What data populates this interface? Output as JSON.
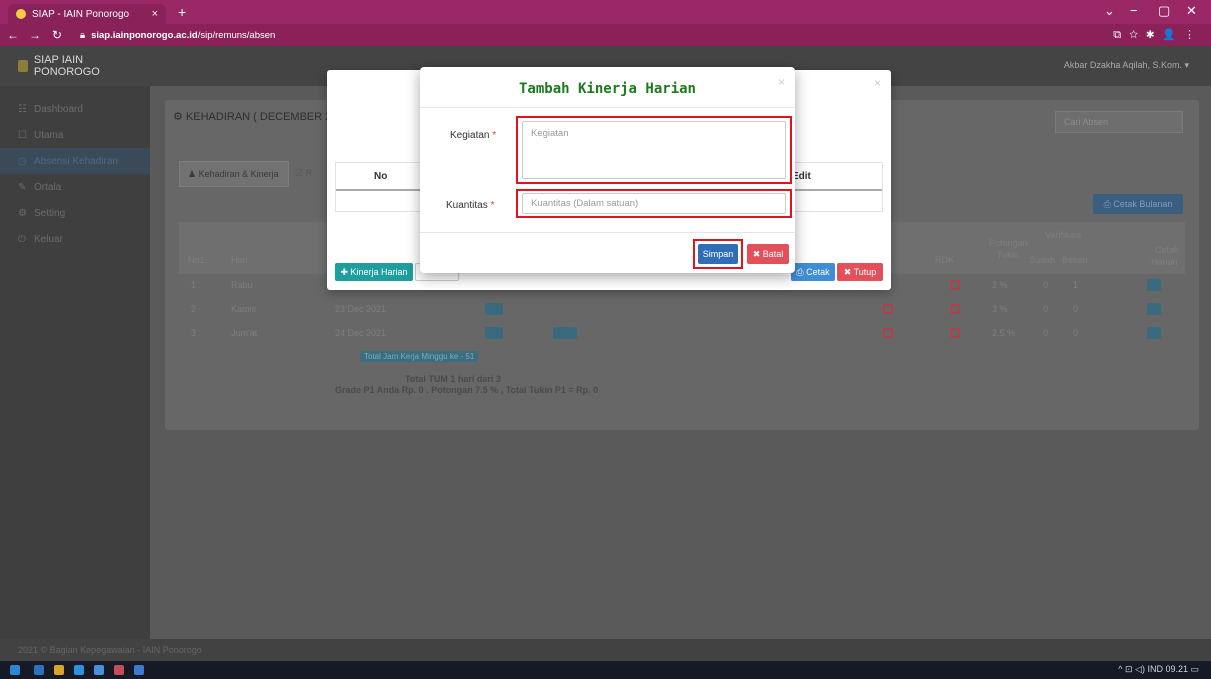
{
  "browser": {
    "tab_title": "SIAP - IAIN Ponorogo",
    "tab_close": "×",
    "new_tab": "+",
    "url_domain": "siap.iainponorogo.ac.id",
    "url_path": "/sip/remuns/absen",
    "window_controls": [
      "⌄",
      "−",
      "▢",
      "✕"
    ],
    "toolbar_icons": [
      "share-icon",
      "star-icon",
      "puzzle-icon",
      "profile-icon",
      "menu-icon"
    ]
  },
  "app": {
    "brand": "SIAP IAIN PONOROGO",
    "user": "Akbar Dzakha Aqilah, S.Kom.",
    "sidebar": [
      {
        "icon": "☷",
        "label": "Dashboard"
      },
      {
        "icon": "☐",
        "label": "Utama"
      },
      {
        "icon": "◷",
        "label": "Absensi Kehadiran"
      },
      {
        "icon": "✎",
        "label": "Ortala"
      },
      {
        "icon": "⚙",
        "label": "Setting"
      },
      {
        "icon": "⏻",
        "label": "Keluar"
      }
    ],
    "panel_title": "⚙ KEHADIRAN ( DECEMBER 20",
    "search_placeholder": "Cari Absen",
    "tabs": [
      "♟ Kehadiran & Kinerja",
      "☑ R"
    ],
    "cetak_bulanan": "⎙ Cetak Bulanan",
    "table_headers": {
      "no": "No1.",
      "hari": "Hari",
      "rdk": "RDK",
      "potongan": "Potongan",
      "tukin": "Tukin",
      "verifikasi": "Verifikasi",
      "sudah": "Sudah",
      "belum": "Belum",
      "cetak": "Cetak",
      "harian": "Harian"
    },
    "rows": [
      {
        "no": "1",
        "hari": "Rabu",
        "date": "",
        "pot": "2 %",
        "sudah": "0",
        "belum": "1"
      },
      {
        "no": "2",
        "hari": "Kamis",
        "date": "23 Dec 2021",
        "pot": "3 %",
        "sudah": "0",
        "belum": "0"
      },
      {
        "no": "3",
        "hari": "Jum'at",
        "date": "24 Dec 2021",
        "pot": "2.5 %",
        "sudah": "0",
        "belum": "0"
      }
    ],
    "total_jam": "Total Jam Kerja Minggu ke - 51",
    "total_tum": "Total TUM 1 hari dari 3",
    "grade_line": "Grade P1 Anda  Rp. 0 . Potongan  7.5 % , Total Tukin P1 =  Rp. 0",
    "footer": "2021 © Bagian Kepegawaian - IAIN Ponorogo"
  },
  "modal_back": {
    "col_no": "No",
    "col_edit": "Edit",
    "btn_kinerja": "✚ Kinerja Harian",
    "btn_cetak": "⎙ Cetak",
    "btn_tutup": "✖ Tutup",
    "close": "×"
  },
  "modal": {
    "title": "Tambah Kinerja Harian",
    "close": "×",
    "kegiatan_label": "Kegiatan",
    "kegiatan_placeholder": "Kegiatan",
    "kuantitas_label": "Kuantitas",
    "kuantitas_placeholder": "Kuantitas (Dalam satuan)",
    "required_mark": "*",
    "simpan": "Simpan",
    "batal": "✖ Batal"
  },
  "taskbar": {
    "tray": "^  ⊡ ◁)  IND  09.21  ▭"
  }
}
